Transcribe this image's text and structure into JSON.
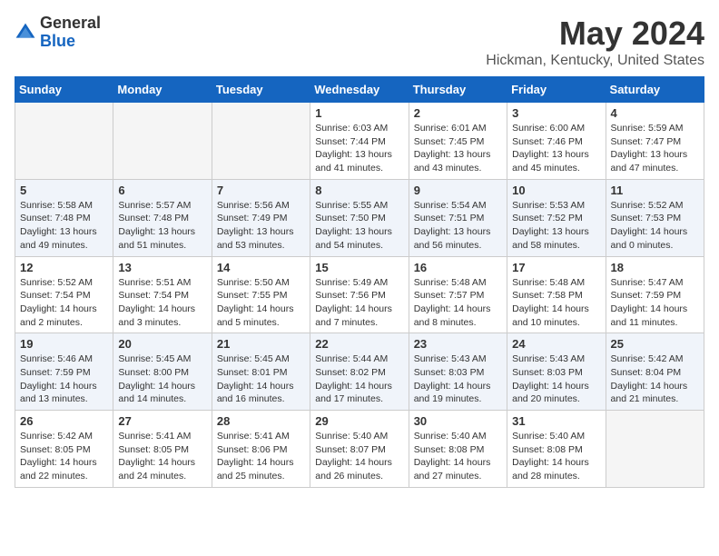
{
  "header": {
    "logo_general": "General",
    "logo_blue": "Blue",
    "title": "May 2024",
    "subtitle": "Hickman, Kentucky, United States"
  },
  "calendar": {
    "weekdays": [
      "Sunday",
      "Monday",
      "Tuesday",
      "Wednesday",
      "Thursday",
      "Friday",
      "Saturday"
    ],
    "weeks": [
      [
        {
          "day": "",
          "empty": true
        },
        {
          "day": "",
          "empty": true
        },
        {
          "day": "",
          "empty": true
        },
        {
          "day": "1",
          "sunrise": "Sunrise: 6:03 AM",
          "sunset": "Sunset: 7:44 PM",
          "daylight": "Daylight: 13 hours and 41 minutes."
        },
        {
          "day": "2",
          "sunrise": "Sunrise: 6:01 AM",
          "sunset": "Sunset: 7:45 PM",
          "daylight": "Daylight: 13 hours and 43 minutes."
        },
        {
          "day": "3",
          "sunrise": "Sunrise: 6:00 AM",
          "sunset": "Sunset: 7:46 PM",
          "daylight": "Daylight: 13 hours and 45 minutes."
        },
        {
          "day": "4",
          "sunrise": "Sunrise: 5:59 AM",
          "sunset": "Sunset: 7:47 PM",
          "daylight": "Daylight: 13 hours and 47 minutes."
        }
      ],
      [
        {
          "day": "5",
          "sunrise": "Sunrise: 5:58 AM",
          "sunset": "Sunset: 7:48 PM",
          "daylight": "Daylight: 13 hours and 49 minutes."
        },
        {
          "day": "6",
          "sunrise": "Sunrise: 5:57 AM",
          "sunset": "Sunset: 7:48 PM",
          "daylight": "Daylight: 13 hours and 51 minutes."
        },
        {
          "day": "7",
          "sunrise": "Sunrise: 5:56 AM",
          "sunset": "Sunset: 7:49 PM",
          "daylight": "Daylight: 13 hours and 53 minutes."
        },
        {
          "day": "8",
          "sunrise": "Sunrise: 5:55 AM",
          "sunset": "Sunset: 7:50 PM",
          "daylight": "Daylight: 13 hours and 54 minutes."
        },
        {
          "day": "9",
          "sunrise": "Sunrise: 5:54 AM",
          "sunset": "Sunset: 7:51 PM",
          "daylight": "Daylight: 13 hours and 56 minutes."
        },
        {
          "day": "10",
          "sunrise": "Sunrise: 5:53 AM",
          "sunset": "Sunset: 7:52 PM",
          "daylight": "Daylight: 13 hours and 58 minutes."
        },
        {
          "day": "11",
          "sunrise": "Sunrise: 5:52 AM",
          "sunset": "Sunset: 7:53 PM",
          "daylight": "Daylight: 14 hours and 0 minutes."
        }
      ],
      [
        {
          "day": "12",
          "sunrise": "Sunrise: 5:52 AM",
          "sunset": "Sunset: 7:54 PM",
          "daylight": "Daylight: 14 hours and 2 minutes."
        },
        {
          "day": "13",
          "sunrise": "Sunrise: 5:51 AM",
          "sunset": "Sunset: 7:54 PM",
          "daylight": "Daylight: 14 hours and 3 minutes."
        },
        {
          "day": "14",
          "sunrise": "Sunrise: 5:50 AM",
          "sunset": "Sunset: 7:55 PM",
          "daylight": "Daylight: 14 hours and 5 minutes."
        },
        {
          "day": "15",
          "sunrise": "Sunrise: 5:49 AM",
          "sunset": "Sunset: 7:56 PM",
          "daylight": "Daylight: 14 hours and 7 minutes."
        },
        {
          "day": "16",
          "sunrise": "Sunrise: 5:48 AM",
          "sunset": "Sunset: 7:57 PM",
          "daylight": "Daylight: 14 hours and 8 minutes."
        },
        {
          "day": "17",
          "sunrise": "Sunrise: 5:48 AM",
          "sunset": "Sunset: 7:58 PM",
          "daylight": "Daylight: 14 hours and 10 minutes."
        },
        {
          "day": "18",
          "sunrise": "Sunrise: 5:47 AM",
          "sunset": "Sunset: 7:59 PM",
          "daylight": "Daylight: 14 hours and 11 minutes."
        }
      ],
      [
        {
          "day": "19",
          "sunrise": "Sunrise: 5:46 AM",
          "sunset": "Sunset: 7:59 PM",
          "daylight": "Daylight: 14 hours and 13 minutes."
        },
        {
          "day": "20",
          "sunrise": "Sunrise: 5:45 AM",
          "sunset": "Sunset: 8:00 PM",
          "daylight": "Daylight: 14 hours and 14 minutes."
        },
        {
          "day": "21",
          "sunrise": "Sunrise: 5:45 AM",
          "sunset": "Sunset: 8:01 PM",
          "daylight": "Daylight: 14 hours and 16 minutes."
        },
        {
          "day": "22",
          "sunrise": "Sunrise: 5:44 AM",
          "sunset": "Sunset: 8:02 PM",
          "daylight": "Daylight: 14 hours and 17 minutes."
        },
        {
          "day": "23",
          "sunrise": "Sunrise: 5:43 AM",
          "sunset": "Sunset: 8:03 PM",
          "daylight": "Daylight: 14 hours and 19 minutes."
        },
        {
          "day": "24",
          "sunrise": "Sunrise: 5:43 AM",
          "sunset": "Sunset: 8:03 PM",
          "daylight": "Daylight: 14 hours and 20 minutes."
        },
        {
          "day": "25",
          "sunrise": "Sunrise: 5:42 AM",
          "sunset": "Sunset: 8:04 PM",
          "daylight": "Daylight: 14 hours and 21 minutes."
        }
      ],
      [
        {
          "day": "26",
          "sunrise": "Sunrise: 5:42 AM",
          "sunset": "Sunset: 8:05 PM",
          "daylight": "Daylight: 14 hours and 22 minutes."
        },
        {
          "day": "27",
          "sunrise": "Sunrise: 5:41 AM",
          "sunset": "Sunset: 8:05 PM",
          "daylight": "Daylight: 14 hours and 24 minutes."
        },
        {
          "day": "28",
          "sunrise": "Sunrise: 5:41 AM",
          "sunset": "Sunset: 8:06 PM",
          "daylight": "Daylight: 14 hours and 25 minutes."
        },
        {
          "day": "29",
          "sunrise": "Sunrise: 5:40 AM",
          "sunset": "Sunset: 8:07 PM",
          "daylight": "Daylight: 14 hours and 26 minutes."
        },
        {
          "day": "30",
          "sunrise": "Sunrise: 5:40 AM",
          "sunset": "Sunset: 8:08 PM",
          "daylight": "Daylight: 14 hours and 27 minutes."
        },
        {
          "day": "31",
          "sunrise": "Sunrise: 5:40 AM",
          "sunset": "Sunset: 8:08 PM",
          "daylight": "Daylight: 14 hours and 28 minutes."
        },
        {
          "day": "",
          "empty": true
        }
      ]
    ]
  }
}
